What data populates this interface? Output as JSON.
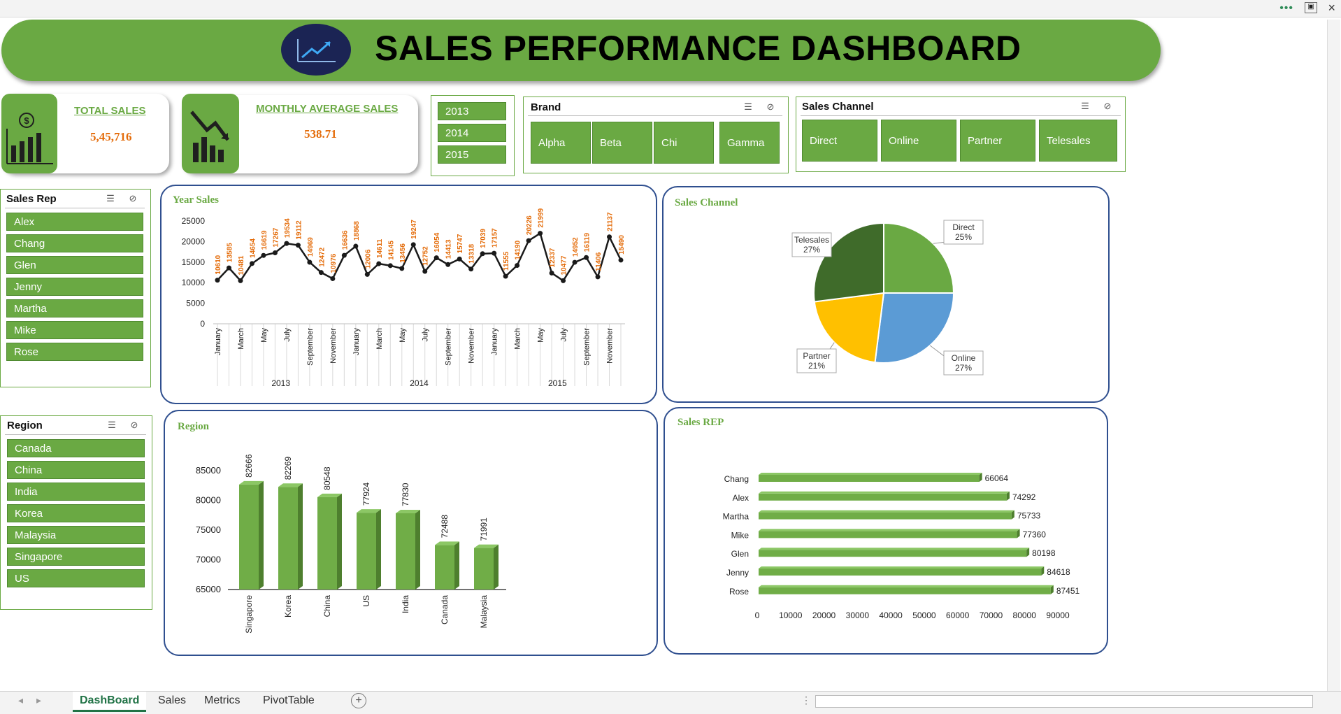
{
  "header": {
    "title": "SALES PERFORMANCE DASHBOARD"
  },
  "kpis": {
    "total_sales": {
      "label": "TOTAL SALES",
      "value": "5,45,716"
    },
    "monthly_avg": {
      "label": "MONTHLY AVERAGE SALES",
      "value": "538.71"
    }
  },
  "year_slicer": {
    "items": [
      "2013",
      "2014",
      "2015"
    ]
  },
  "brand_slicer": {
    "title": "Brand",
    "items": [
      "Alpha",
      "Beta",
      "Chi",
      "Gamma"
    ]
  },
  "channel_slicer": {
    "title": "Sales Channel",
    "items": [
      "Direct",
      "Online",
      "Partner",
      "Telesales"
    ]
  },
  "rep_slicer": {
    "title": "Sales Rep",
    "items": [
      "Alex",
      "Chang",
      "Glen",
      "Jenny",
      "Martha",
      "Mike",
      "Rose"
    ]
  },
  "region_slicer": {
    "title": "Region",
    "items": [
      "Canada",
      "China",
      "India",
      "Korea",
      "Malaysia",
      "Singapore",
      "US"
    ]
  },
  "sheet_tabs": [
    "DashBoard",
    "Sales",
    "Metrics",
    "PivotTable"
  ],
  "colors": {
    "accent": "#6aa943",
    "dark_green": "#3f6b2a",
    "orange": "#e46c0a",
    "blue_border": "#2f4f8f",
    "online": "#5b9bd5",
    "partner": "#ffc000"
  },
  "chart_data": [
    {
      "type": "line",
      "title": "Year Sales",
      "ylim": [
        0,
        25000
      ],
      "yticks": [
        0,
        5000,
        10000,
        15000,
        20000,
        25000
      ],
      "years": [
        "2013",
        "2014",
        "2015"
      ],
      "month_labels": [
        "January",
        "",
        "March",
        "",
        "May",
        "",
        "July",
        "",
        "September",
        "",
        "November",
        ""
      ],
      "values": [
        10610,
        13585,
        10481,
        14654,
        16619,
        17267,
        19534,
        19112,
        14969,
        12472,
        10976,
        16636,
        18868,
        12006,
        14611,
        14145,
        13456,
        19247,
        12752,
        16054,
        14413,
        15747,
        13318,
        17039,
        17157,
        11555,
        14190,
        20226,
        21999,
        12337,
        10477,
        14952,
        16119,
        11406,
        21137,
        15490
      ]
    },
    {
      "type": "pie",
      "title": "Sales Channel",
      "slices": [
        {
          "label": "Direct",
          "pct_label": "25%",
          "value": 25,
          "color": "#6aa943"
        },
        {
          "label": "Online",
          "pct_label": "27%",
          "value": 27,
          "color": "#5b9bd5"
        },
        {
          "label": "Partner",
          "pct_label": "21%",
          "value": 21,
          "color": "#ffc000"
        },
        {
          "label": "Telesales",
          "pct_label": "27%",
          "value": 27,
          "color": "#3f6b2a"
        }
      ]
    },
    {
      "type": "bar",
      "title": "Region",
      "categories": [
        "Singapore",
        "Korea",
        "China",
        "US",
        "India",
        "Canada",
        "Malaysia"
      ],
      "values": [
        82666,
        82269,
        80548,
        77924,
        77830,
        72488,
        71991
      ],
      "ylim": [
        65000,
        85000
      ],
      "yticks": [
        65000,
        70000,
        75000,
        80000,
        85000
      ]
    },
    {
      "type": "bar",
      "orientation": "horizontal",
      "title": "Sales REP",
      "categories": [
        "Chang",
        "Alex",
        "Martha",
        "Mike",
        "Glen",
        "Jenny",
        "Rose"
      ],
      "values": [
        66064,
        74292,
        75733,
        77360,
        80198,
        84618,
        87451
      ],
      "xlim": [
        0,
        90000
      ],
      "xticks": [
        0,
        10000,
        20000,
        30000,
        40000,
        50000,
        60000,
        70000,
        80000,
        90000
      ]
    }
  ]
}
